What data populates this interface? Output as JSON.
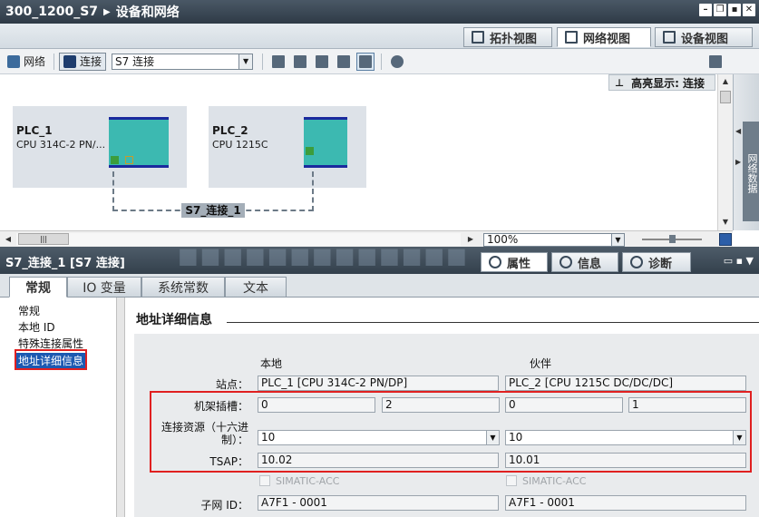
{
  "titlebar": {
    "project": "300_1200_S7",
    "section": "设备和网络",
    "btn_min": "–",
    "btn_restore": "❐",
    "btn_float": "▪",
    "btn_close": "✕"
  },
  "view_tabs": [
    {
      "label": "拓扑视图"
    },
    {
      "label": "网络视图"
    },
    {
      "label": "设备视图"
    }
  ],
  "toolbar": {
    "network_label": "网络",
    "connection_label": "连接",
    "connection_type": "S7 连接"
  },
  "canvas": {
    "highlight_label": "高亮显示: 连接",
    "connection_label": "S7_连接_1",
    "devices": [
      {
        "name": "PLC_1",
        "type": "CPU 314C-2 PN/..."
      },
      {
        "name": "PLC_2",
        "type": "CPU 1215C"
      }
    ],
    "zoom": "100%",
    "side_tab": "网络数据"
  },
  "inspector": {
    "title": "S7_连接_1 [S7 连接]",
    "tabs": [
      {
        "label": "属性"
      },
      {
        "label": "信息"
      },
      {
        "label": "诊断"
      }
    ],
    "subtabs": [
      {
        "label": "常规"
      },
      {
        "label": "IO 变量"
      },
      {
        "label": "系统常数"
      },
      {
        "label": "文本"
      }
    ],
    "nav": [
      {
        "label": "常规"
      },
      {
        "label": "本地 ID"
      },
      {
        "label": "特殊连接属性"
      },
      {
        "label": "地址详细信息"
      }
    ]
  },
  "address_details": {
    "title": "地址详细信息",
    "col_local": "本地",
    "col_partner": "伙伴",
    "station_label": "站点：",
    "rack_slot_label": "机架插槽：",
    "conn_resource_label_1": "连接资源（十六进",
    "conn_resource_label_2": "制）：",
    "tsap_label": "TSAP：",
    "subnet_label": "子网 ID：",
    "local": {
      "station": "PLC_1 [CPU 314C-2 PN/DP]",
      "rack": "0",
      "slot": "2",
      "conn_resource": "10",
      "tsap": "10.02",
      "simatic_acc": "SIMATIC-ACC",
      "subnet": "A7F1 - 0001"
    },
    "partner": {
      "station": "PLC_2 [CPU 1215C DC/DC/DC]",
      "rack": "0",
      "slot": "1",
      "conn_resource": "10",
      "tsap": "10.01",
      "simatic_acc": "SIMATIC-ACC",
      "subnet": "A7F1 - 0001"
    }
  }
}
